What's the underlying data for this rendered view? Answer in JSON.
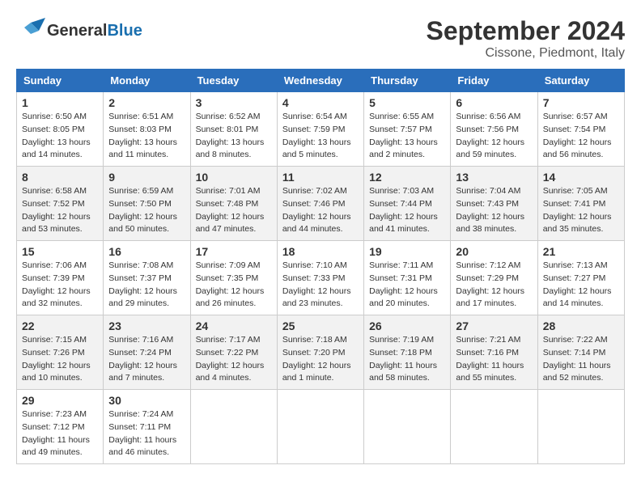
{
  "header": {
    "logo_general": "General",
    "logo_blue": "Blue",
    "title": "September 2024",
    "subtitle": "Cissone, Piedmont, Italy"
  },
  "weekdays": [
    "Sunday",
    "Monday",
    "Tuesday",
    "Wednesday",
    "Thursday",
    "Friday",
    "Saturday"
  ],
  "weeks": [
    [
      {
        "day": "1",
        "info": "Sunrise: 6:50 AM\nSunset: 8:05 PM\nDaylight: 13 hours\nand 14 minutes."
      },
      {
        "day": "2",
        "info": "Sunrise: 6:51 AM\nSunset: 8:03 PM\nDaylight: 13 hours\nand 11 minutes."
      },
      {
        "day": "3",
        "info": "Sunrise: 6:52 AM\nSunset: 8:01 PM\nDaylight: 13 hours\nand 8 minutes."
      },
      {
        "day": "4",
        "info": "Sunrise: 6:54 AM\nSunset: 7:59 PM\nDaylight: 13 hours\nand 5 minutes."
      },
      {
        "day": "5",
        "info": "Sunrise: 6:55 AM\nSunset: 7:57 PM\nDaylight: 13 hours\nand 2 minutes."
      },
      {
        "day": "6",
        "info": "Sunrise: 6:56 AM\nSunset: 7:56 PM\nDaylight: 12 hours\nand 59 minutes."
      },
      {
        "day": "7",
        "info": "Sunrise: 6:57 AM\nSunset: 7:54 PM\nDaylight: 12 hours\nand 56 minutes."
      }
    ],
    [
      {
        "day": "8",
        "info": "Sunrise: 6:58 AM\nSunset: 7:52 PM\nDaylight: 12 hours\nand 53 minutes."
      },
      {
        "day": "9",
        "info": "Sunrise: 6:59 AM\nSunset: 7:50 PM\nDaylight: 12 hours\nand 50 minutes."
      },
      {
        "day": "10",
        "info": "Sunrise: 7:01 AM\nSunset: 7:48 PM\nDaylight: 12 hours\nand 47 minutes."
      },
      {
        "day": "11",
        "info": "Sunrise: 7:02 AM\nSunset: 7:46 PM\nDaylight: 12 hours\nand 44 minutes."
      },
      {
        "day": "12",
        "info": "Sunrise: 7:03 AM\nSunset: 7:44 PM\nDaylight: 12 hours\nand 41 minutes."
      },
      {
        "day": "13",
        "info": "Sunrise: 7:04 AM\nSunset: 7:43 PM\nDaylight: 12 hours\nand 38 minutes."
      },
      {
        "day": "14",
        "info": "Sunrise: 7:05 AM\nSunset: 7:41 PM\nDaylight: 12 hours\nand 35 minutes."
      }
    ],
    [
      {
        "day": "15",
        "info": "Sunrise: 7:06 AM\nSunset: 7:39 PM\nDaylight: 12 hours\nand 32 minutes."
      },
      {
        "day": "16",
        "info": "Sunrise: 7:08 AM\nSunset: 7:37 PM\nDaylight: 12 hours\nand 29 minutes."
      },
      {
        "day": "17",
        "info": "Sunrise: 7:09 AM\nSunset: 7:35 PM\nDaylight: 12 hours\nand 26 minutes."
      },
      {
        "day": "18",
        "info": "Sunrise: 7:10 AM\nSunset: 7:33 PM\nDaylight: 12 hours\nand 23 minutes."
      },
      {
        "day": "19",
        "info": "Sunrise: 7:11 AM\nSunset: 7:31 PM\nDaylight: 12 hours\nand 20 minutes."
      },
      {
        "day": "20",
        "info": "Sunrise: 7:12 AM\nSunset: 7:29 PM\nDaylight: 12 hours\nand 17 minutes."
      },
      {
        "day": "21",
        "info": "Sunrise: 7:13 AM\nSunset: 7:27 PM\nDaylight: 12 hours\nand 14 minutes."
      }
    ],
    [
      {
        "day": "22",
        "info": "Sunrise: 7:15 AM\nSunset: 7:26 PM\nDaylight: 12 hours\nand 10 minutes."
      },
      {
        "day": "23",
        "info": "Sunrise: 7:16 AM\nSunset: 7:24 PM\nDaylight: 12 hours\nand 7 minutes."
      },
      {
        "day": "24",
        "info": "Sunrise: 7:17 AM\nSunset: 7:22 PM\nDaylight: 12 hours\nand 4 minutes."
      },
      {
        "day": "25",
        "info": "Sunrise: 7:18 AM\nSunset: 7:20 PM\nDaylight: 12 hours\nand 1 minute."
      },
      {
        "day": "26",
        "info": "Sunrise: 7:19 AM\nSunset: 7:18 PM\nDaylight: 11 hours\nand 58 minutes."
      },
      {
        "day": "27",
        "info": "Sunrise: 7:21 AM\nSunset: 7:16 PM\nDaylight: 11 hours\nand 55 minutes."
      },
      {
        "day": "28",
        "info": "Sunrise: 7:22 AM\nSunset: 7:14 PM\nDaylight: 11 hours\nand 52 minutes."
      }
    ],
    [
      {
        "day": "29",
        "info": "Sunrise: 7:23 AM\nSunset: 7:12 PM\nDaylight: 11 hours\nand 49 minutes."
      },
      {
        "day": "30",
        "info": "Sunrise: 7:24 AM\nSunset: 7:11 PM\nDaylight: 11 hours\nand 46 minutes."
      },
      {
        "day": "",
        "info": ""
      },
      {
        "day": "",
        "info": ""
      },
      {
        "day": "",
        "info": ""
      },
      {
        "day": "",
        "info": ""
      },
      {
        "day": "",
        "info": ""
      }
    ]
  ]
}
